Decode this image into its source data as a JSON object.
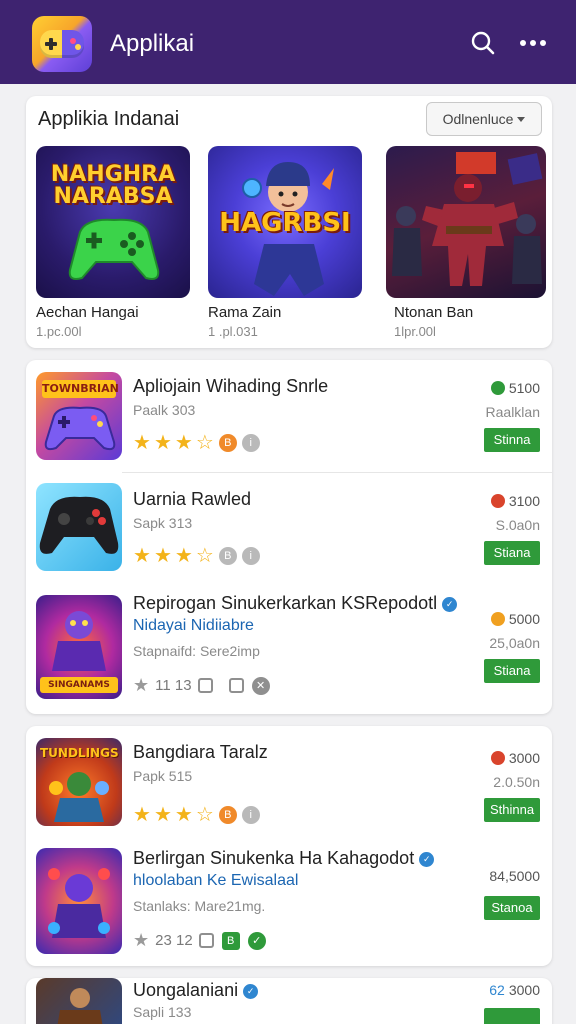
{
  "appbar": {
    "title": "Applikai",
    "search_icon": "search-icon",
    "more_icon": "more-vertical-icon",
    "color": "#3e2370"
  },
  "featured": {
    "title": "Applikia Indanai",
    "dropdown": "Odlnenluce",
    "items": [
      {
        "name": "Aechan Hangai",
        "sub": "1.pc.00l",
        "art_text": "NAHGHRA NARABSA"
      },
      {
        "name": "Rama Zain",
        "sub": "1 .pl.031",
        "art_text": "HAGRBSI"
      },
      {
        "name": "Ntonan Ban",
        "sub": "1lpr.00l",
        "art_text": ""
      }
    ]
  },
  "list1": {
    "rows": [
      {
        "title": "Apliojain Wihading Snrle",
        "sub": "Paalk 303",
        "price": "5100",
        "price_sub": "Raalklan",
        "button": "Stinna",
        "price_color": "#2f9a3a"
      },
      {
        "title": "Uarnia Rawled",
        "sub": "Sapk 313",
        "price": "3100",
        "price_sub": "S.0a0n",
        "button": "Stiana",
        "price_color": "#d9442c"
      },
      {
        "title": "Repirogan Sinukerkarkan KSRepodotl",
        "sub2": "Nidayai Nidiiabre",
        "sub": "Stapnaifd: Sere2imp",
        "meta": "11 13",
        "price": "5000",
        "price_sub": "25,0a0n",
        "button": "Stiana",
        "price_color": "#f0a020"
      }
    ]
  },
  "list2": {
    "rows": [
      {
        "title": "Bangdiara Taralz",
        "sub": "Papk 515",
        "price": "3000",
        "price_sub": "2.0.50n",
        "button": "Sthinna",
        "price_color": "#d9442c"
      },
      {
        "title": "Berlirgan Sinukenka Ha Kahagodot",
        "sub2": "hloolaban Ke Ewisalaal",
        "sub": "Stanlaks: Mare21mg.",
        "meta": "23 12",
        "price": "84,5000",
        "price_sub": "",
        "button": "Stanoa",
        "price_color": ""
      }
    ]
  },
  "list3": {
    "rows": [
      {
        "title": "Uongalaniani",
        "sub": "Sapli 133",
        "price": "3000",
        "price_prefix": "62",
        "price_color": ""
      }
    ]
  }
}
